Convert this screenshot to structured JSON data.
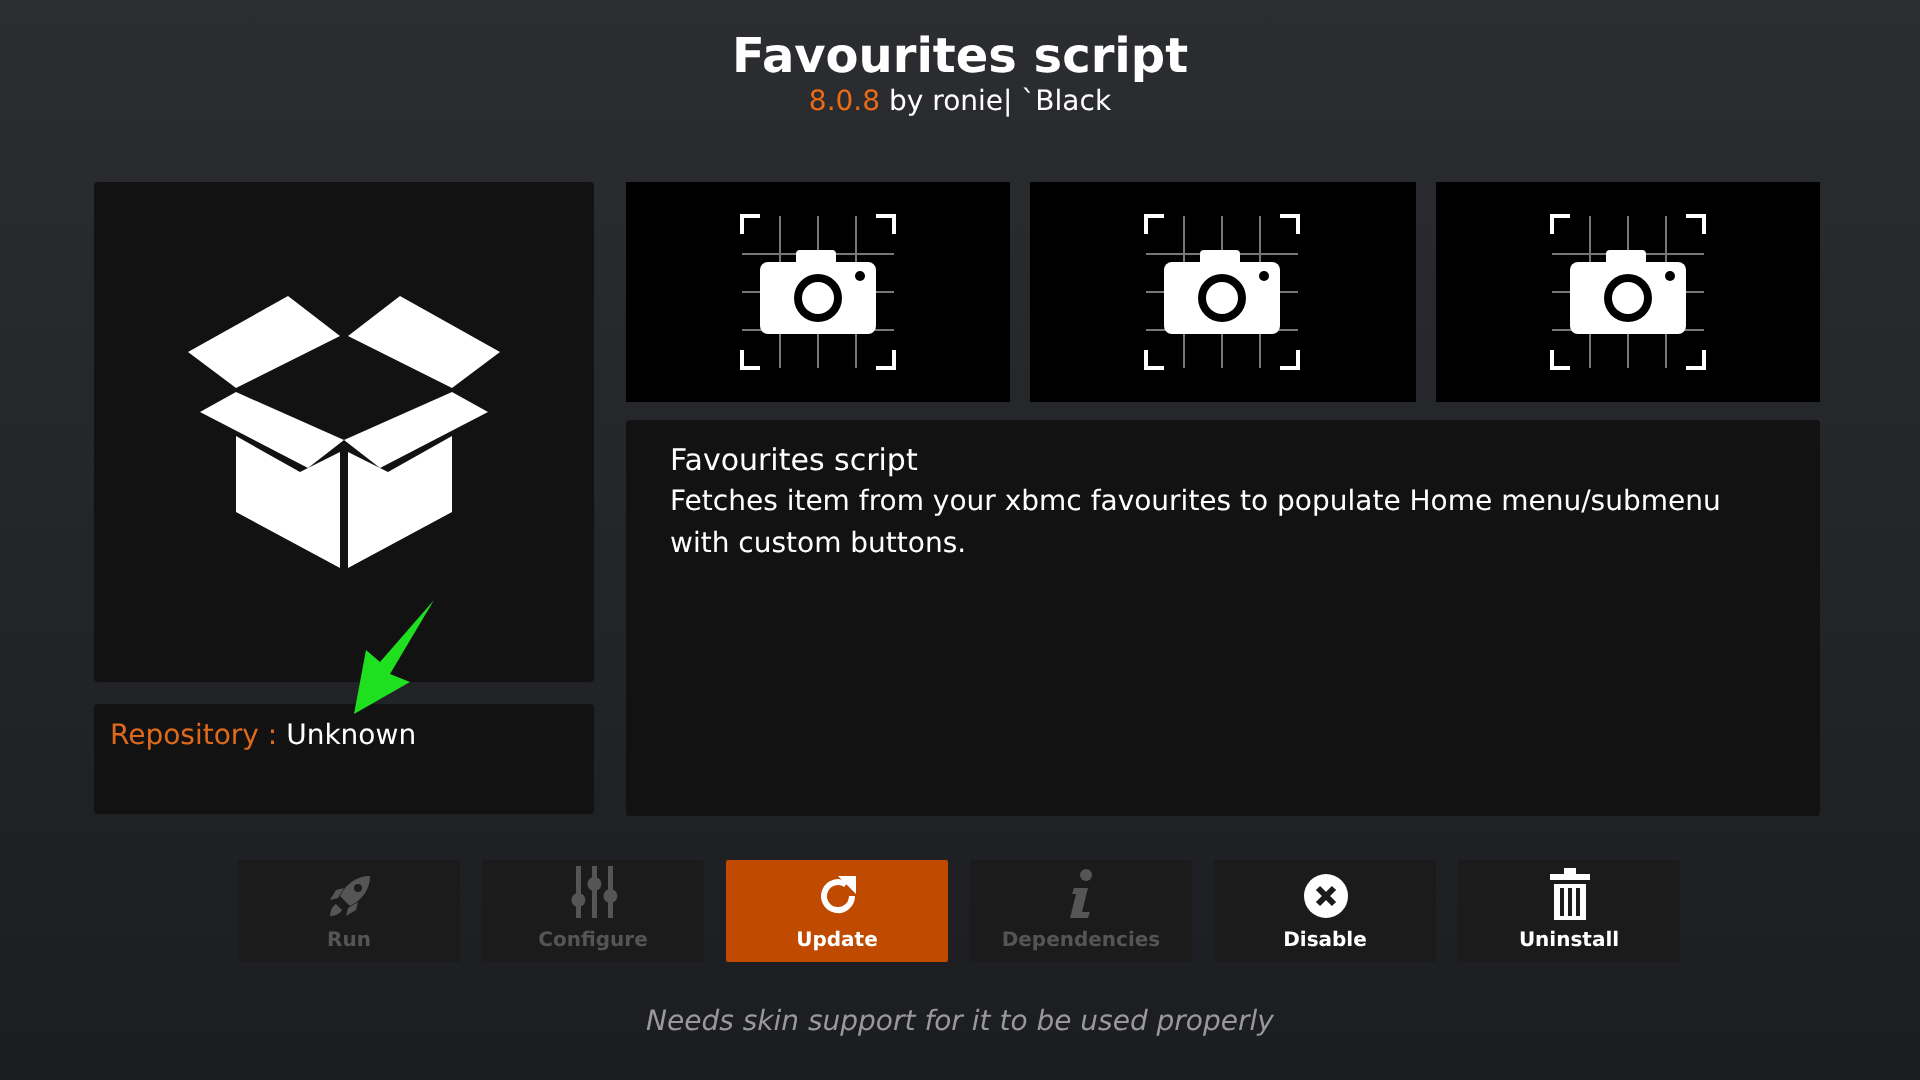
{
  "header": {
    "title": "Favourites script",
    "version": "8.0.8",
    "author": "by ronie| `Black"
  },
  "repository": {
    "label": "Repository :",
    "value": "Unknown"
  },
  "screenshots": [
    {
      "kind": "placeholder"
    },
    {
      "kind": "placeholder"
    },
    {
      "kind": "placeholder"
    }
  ],
  "description": {
    "title": "Favourites script",
    "text": "Fetches item from your xbmc favourites to populate Home menu/submenu with custom buttons."
  },
  "buttons": [
    {
      "kind": "rocket",
      "label": "Run",
      "disabled": true,
      "selected": false
    },
    {
      "kind": "sliders",
      "label": "Configure",
      "disabled": true,
      "selected": false
    },
    {
      "kind": "refresh",
      "label": "Update",
      "disabled": false,
      "selected": true
    },
    {
      "kind": "info",
      "label": "Dependencies",
      "disabled": true,
      "selected": false
    },
    {
      "kind": "close",
      "label": "Disable",
      "disabled": false,
      "selected": false
    },
    {
      "kind": "trash",
      "label": "Uninstall",
      "disabled": false,
      "selected": false
    }
  ],
  "footer": "Needs skin support for it to be used properly"
}
